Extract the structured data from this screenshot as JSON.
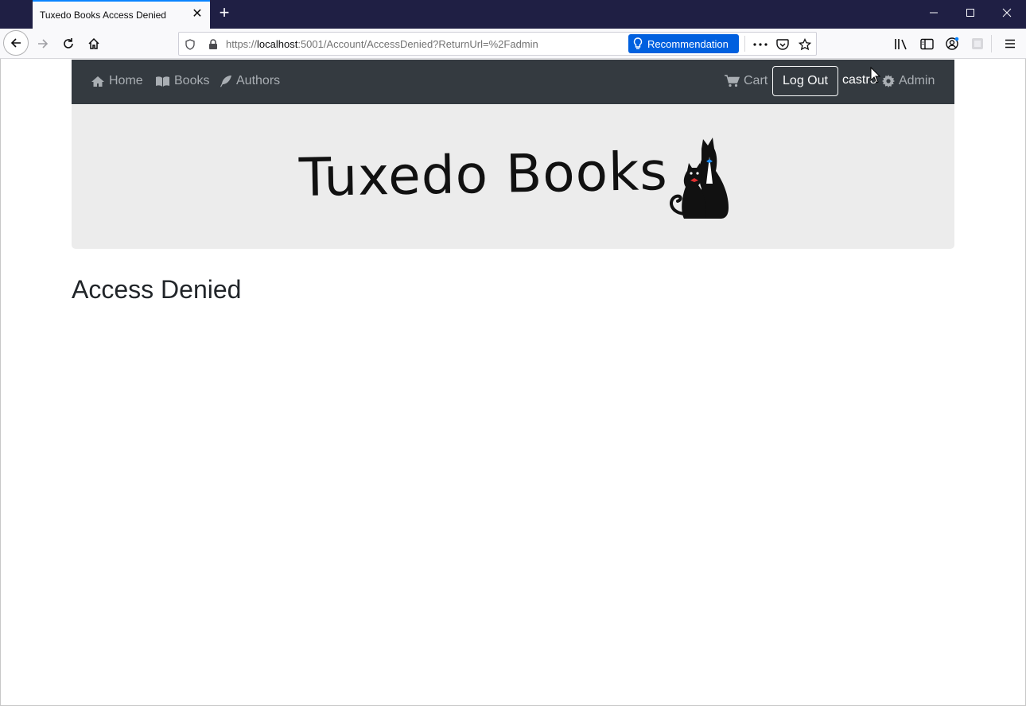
{
  "browser": {
    "tab_title": "Tuxedo Books Access Denied",
    "url_prefix": "https://",
    "url_host": "localhost",
    "url_rest": ":5001/Account/AccessDenied?ReturnUrl=%2Fadmin",
    "recommendation_label": "Recommendation"
  },
  "nav": {
    "home": "Home",
    "books": "Books",
    "authors": "Authors",
    "cart": "Cart",
    "logout": "Log Out",
    "username": "castro",
    "admin": "Admin"
  },
  "banner": {
    "logo_text": "Tuxedo Books"
  },
  "main": {
    "heading": "Access Denied"
  },
  "colors": {
    "navbar_bg": "#343a40",
    "jumbotron_bg": "#ececec",
    "accent": "#0060df"
  }
}
